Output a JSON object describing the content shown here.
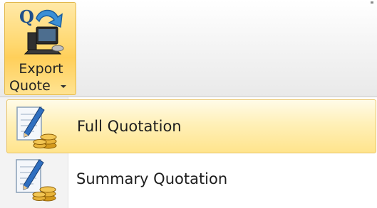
{
  "ribbon": {
    "export_button": {
      "label_line1": "Export",
      "label_line2": "Quote",
      "icon": "export-quote-icon"
    }
  },
  "menu": {
    "items": [
      {
        "label": "Full Quotation",
        "icon": "quotation-coins-icon",
        "highlighted": true
      },
      {
        "label": "Summary Quotation",
        "icon": "quotation-coins-icon",
        "highlighted": false
      }
    ]
  },
  "colors": {
    "button_highlight": "#ffd870",
    "menu_highlight": "#fff0b8",
    "highlight_border": "#e9c46a"
  }
}
